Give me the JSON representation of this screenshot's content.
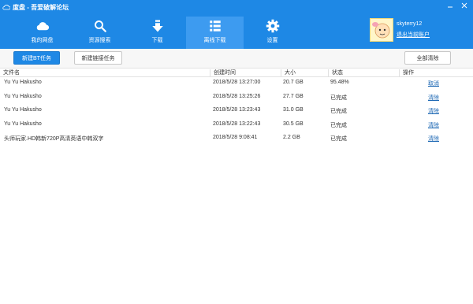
{
  "app": {
    "title": "度盘 - 吾爱破解论坛"
  },
  "nav": {
    "items": [
      {
        "label": "我的网盘",
        "icon": "cloud-icon"
      },
      {
        "label": "资源搜索",
        "icon": "search-icon"
      },
      {
        "label": "下载",
        "icon": "download-icon"
      },
      {
        "label": "离线下载",
        "icon": "list-icon"
      },
      {
        "label": "设置",
        "icon": "gear-icon"
      }
    ],
    "active_index": 3
  },
  "user": {
    "name": "skyterry12",
    "logout_label": "退出当前账户"
  },
  "toolbar": {
    "new_bt_label": "新建BT任务",
    "new_link_label": "新建链接任务",
    "clear_all_label": "全部清除"
  },
  "table": {
    "columns": [
      "文件名",
      "创建时间",
      "大小",
      "状态",
      "操作"
    ],
    "rows": [
      {
        "name": "Yu Yu Hakusho",
        "time": "2018/5/28 13:27:00",
        "size": "20.7 GB",
        "status": "95.48%",
        "action": "取消"
      },
      {
        "name": "Yu Yu Hakusho",
        "time": "2018/5/28 13:25:26",
        "size": "27.7 GB",
        "status": "已完成",
        "action": "清除"
      },
      {
        "name": "Yu Yu Hakusho",
        "time": "2018/5/28 13:23:43",
        "size": "31.0 GB",
        "status": "已完成",
        "action": "清除"
      },
      {
        "name": "Yu Yu Hakusho",
        "time": "2018/5/28 13:22:43",
        "size": "30.5 GB",
        "status": "已完成",
        "action": "清除"
      },
      {
        "name": "头师玩家.HD韩新720P高清英语中韩双字",
        "time": "2018/5/28 9:08:41",
        "size": "2.2 GB",
        "status": "已完成",
        "action": "清除"
      }
    ]
  },
  "colors": {
    "brand": "#1e88e5",
    "active_nav": "#3d9bf0",
    "link": "#1a66b3"
  }
}
